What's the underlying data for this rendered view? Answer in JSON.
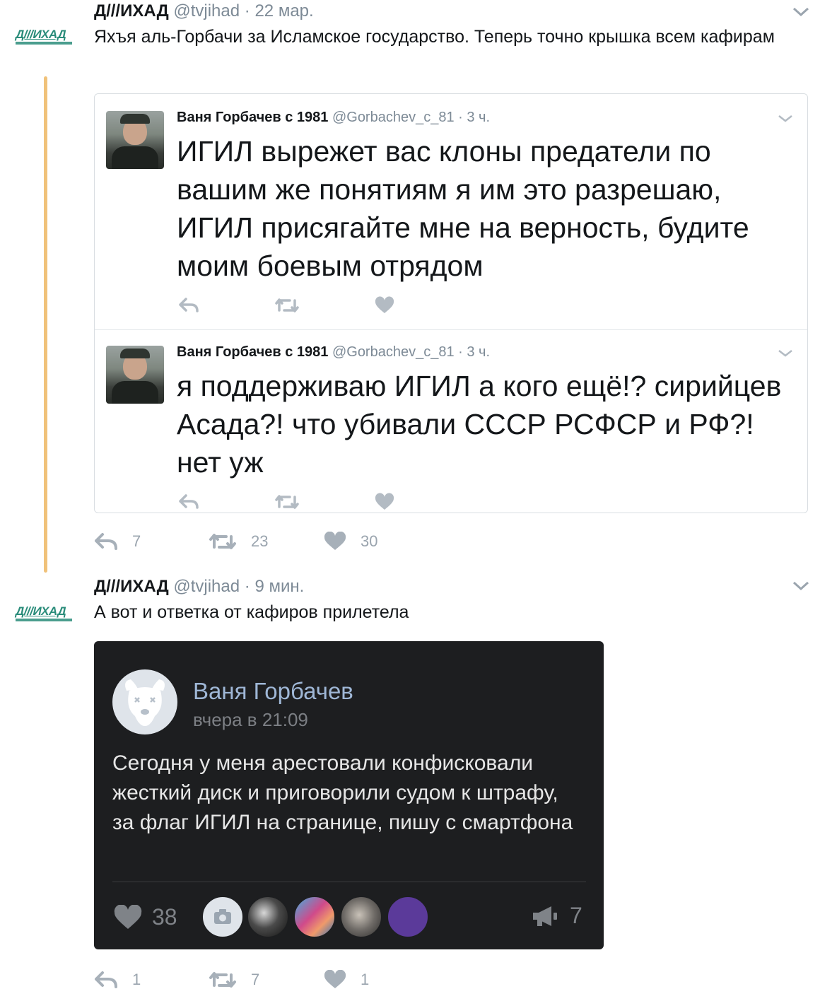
{
  "colors": {
    "accent_line": "#f0c27a",
    "brand_green": "#2a8c7a",
    "muted": "#7d8a96",
    "vk_name": "#9fb7d6"
  },
  "tweet1": {
    "logo_text": "Д///ИХАД",
    "name": "Д///ИХАД",
    "handle": "@tvjihad",
    "dot": "·",
    "time": "22 мар.",
    "text": "Яхъя аль-Горбачи за Исламское государство. Теперь точно крышка всем кафирам",
    "quotes": [
      {
        "name": "Ваня Горбачев с 1981",
        "handle": "@Gorbachev_c_81 ·",
        "time": "3 ч.",
        "text": "ИГИЛ вырежет вас клоны предатели по вашим же понятиям я им это разрешаю, ИГИЛ присягайте мне на верность, будите моим боевым отрядом"
      },
      {
        "name": "Ваня Горбачев с 1981",
        "handle": "@Gorbachev_c_81 ·",
        "time": "3 ч.",
        "text": "я поддерживаю ИГИЛ а кого ещё!? сирийцев Асада?!  что убивали СССР РСФСР и РФ?! нет уж"
      }
    ],
    "stats": {
      "replies": "7",
      "retweets": "23",
      "likes": "30"
    }
  },
  "tweet2": {
    "logo_text": "Д///ИХАД",
    "name": "Д///ИХАД",
    "handle": "@tvjihad",
    "dot": "·",
    "time": "9 мин.",
    "text": "А вот и ответка от кафиров прилетела",
    "embed": {
      "author": "Ваня Горбачев",
      "date": "вчера в 21:09",
      "text": "Сегодня у меня арестовали конфисковали жесткий диск и приговорили судом к штрафу, за флаг ИГИЛ на странице, пишу с смартфона",
      "likes": "38",
      "shares": "7",
      "icons": [
        "heart-icon",
        "camera-icon",
        "megaphone-icon",
        "deactivated-dog-avatar-icon"
      ]
    },
    "stats": {
      "replies": "1",
      "retweets": "7",
      "likes": "1"
    }
  },
  "icons": [
    "chevron-down-icon",
    "reply-icon",
    "retweet-icon",
    "heart-icon"
  ]
}
